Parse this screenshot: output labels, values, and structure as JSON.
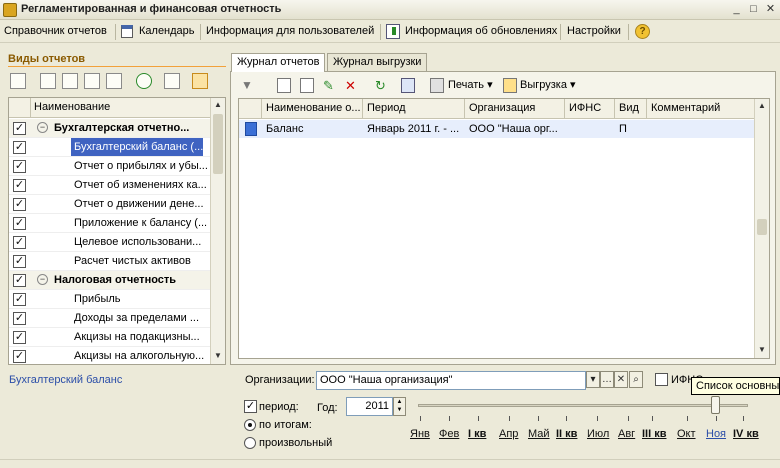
{
  "window": {
    "title": "Регламентированная и финансовая отчетность"
  },
  "menu": {
    "directories": "Справочник отчетов",
    "calendar": "Календарь",
    "user_info": "Информация для пользователей",
    "updates": "Информация об обновлениях",
    "settings": "Настройки"
  },
  "left": {
    "title": "Виды отчетов",
    "column": "Наименование",
    "rows": [
      {
        "label": "Бухгалтерская отчетно...",
        "type": "group",
        "checked": true
      },
      {
        "label": "Бухгалтерский баланс (...",
        "type": "item",
        "checked": true,
        "selected": true
      },
      {
        "label": "Отчет о прибылях и убы...",
        "type": "item",
        "checked": true
      },
      {
        "label": "Отчет об изменениях ка...",
        "type": "item",
        "checked": true
      },
      {
        "label": "Отчет о движении дене...",
        "type": "item",
        "checked": true
      },
      {
        "label": "Приложение к балансу (...",
        "type": "item",
        "checked": true
      },
      {
        "label": "Целевое использовани...",
        "type": "item",
        "checked": true
      },
      {
        "label": "Расчет чистых активов",
        "type": "item",
        "checked": true
      },
      {
        "label": "Налоговая отчетность",
        "type": "group",
        "checked": true
      },
      {
        "label": "Прибыль",
        "type": "item",
        "checked": true
      },
      {
        "label": "Доходы за пределами ...",
        "type": "item",
        "checked": true
      },
      {
        "label": "Акцизы на подакцизны...",
        "type": "item",
        "checked": true
      },
      {
        "label": "Акцизы на алкогольную...",
        "type": "item",
        "checked": true
      }
    ],
    "selected_link": "Бухгалтерский баланс"
  },
  "tabs": {
    "journal": "Журнал отчетов",
    "export": "Журнал выгрузки"
  },
  "toolbar": {
    "print": "Печать",
    "export": "Выгрузка"
  },
  "grid": {
    "columns": [
      "Наименование о...",
      "Период",
      "Организация",
      "ИФНС",
      "Вид",
      "Комментарий"
    ],
    "rows": [
      {
        "name": "Баланс",
        "period": "Январь 2011 г. - ...",
        "org": "ООО \"Наша орг...",
        "ifns": "",
        "kind": "П",
        "comment": ""
      }
    ]
  },
  "filters": {
    "org_label": "Организации:",
    "org_value": "ООО \"Наша организация\"",
    "ifns_label": "ИФНС",
    "period_label": "период:",
    "year_label": "Год:",
    "year_value": "2011",
    "by_totals": "по итогам:",
    "arbitrary": "произвольный",
    "months": [
      "Янв",
      "Фев",
      "I кв",
      "Апр",
      "Май",
      "II кв",
      "Июл",
      "Авг",
      "III кв",
      "Окт",
      "Ноя",
      "IV кв"
    ],
    "slider_level_month_index": 10
  },
  "tooltip": "Список основных"
}
